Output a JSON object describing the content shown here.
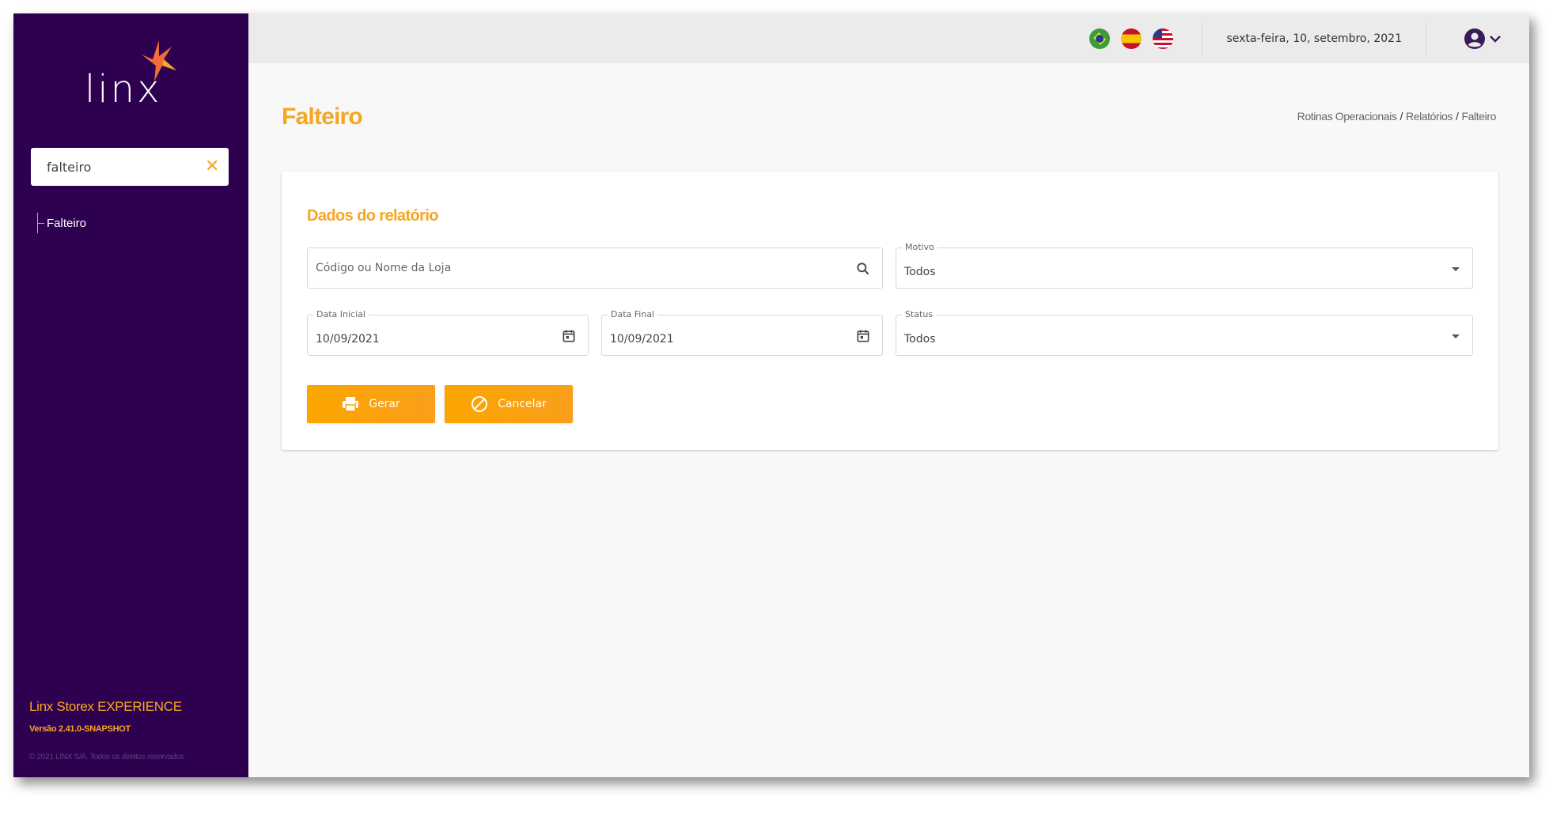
{
  "brand": {
    "logo_text": "linx",
    "accent_color": "#f5a623",
    "sidebar_color": "#2e0150"
  },
  "sidebar": {
    "search_value": "falteiro",
    "menu_items": [
      {
        "label": "Falteiro"
      }
    ],
    "footer": {
      "app_name": "Linx Storex EXPERIENCE",
      "version": "Versão 2.41.0-SNAPSHOT",
      "copyright": "© 2021 LINX S/A. Todos os direitos reservados"
    }
  },
  "topbar": {
    "languages": [
      "pt-BR",
      "es",
      "en-US"
    ],
    "date": "sexta-feira, 10, setembro, 2021"
  },
  "page": {
    "title": "Falteiro",
    "breadcrumb": [
      "Rotinas Operacionais",
      "Relatórios",
      "Falteiro"
    ]
  },
  "form": {
    "section_title": "Dados do relatório",
    "store_search": {
      "placeholder": "Código ou Nome da Loja",
      "value": ""
    },
    "motivo": {
      "label": "Motivo",
      "value": "Todos"
    },
    "data_inicial": {
      "label": "Data Inicial",
      "value": "10/09/2021"
    },
    "data_final": {
      "label": "Data Final",
      "value": "10/09/2021"
    },
    "status": {
      "label": "Status",
      "value": "Todos"
    },
    "buttons": {
      "generate": "Gerar",
      "cancel": "Cancelar"
    }
  }
}
